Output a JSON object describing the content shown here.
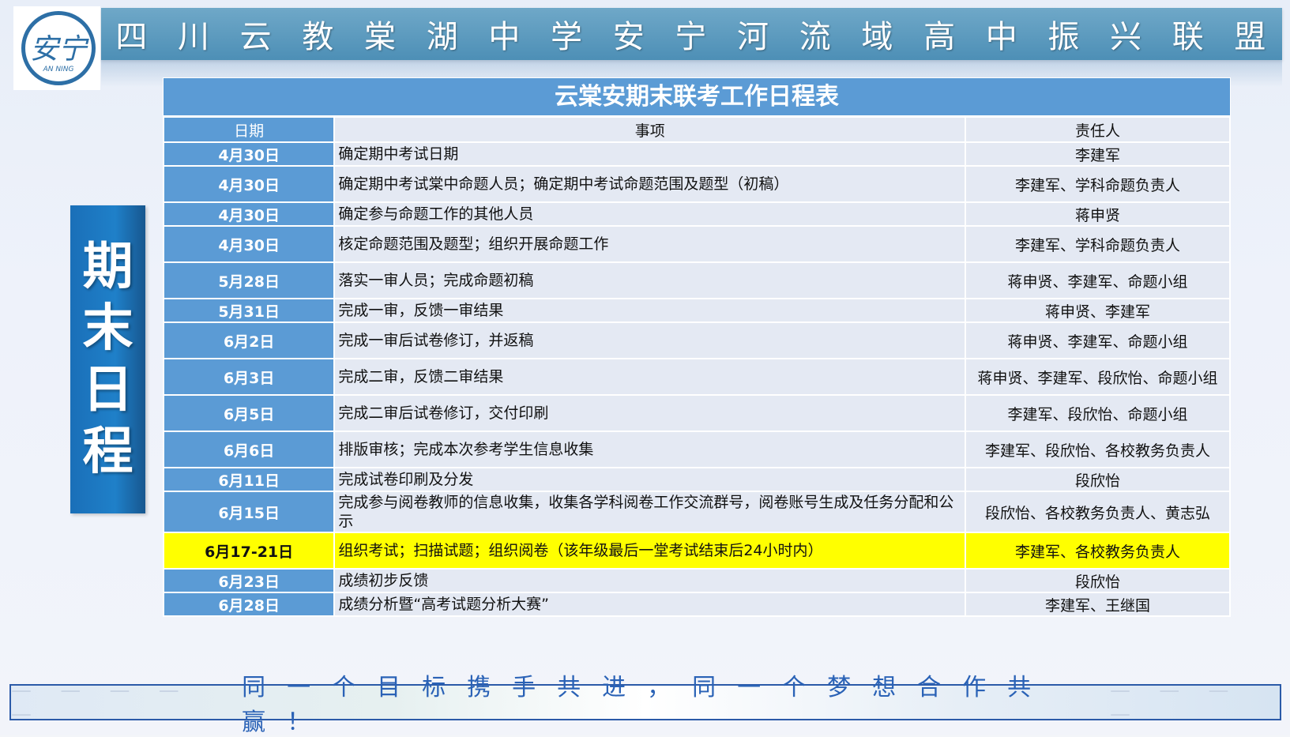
{
  "banner": {
    "chars": [
      "四",
      "川",
      "云",
      "教",
      "棠",
      "湖",
      "中",
      "学",
      "安",
      "宁",
      "河",
      "流",
      "域",
      "高",
      "中",
      "振",
      "兴",
      "联",
      "盟"
    ]
  },
  "logo": {
    "main": "安宁",
    "sub": "AN NING"
  },
  "side_title": [
    "期",
    "末",
    "日",
    "程"
  ],
  "table": {
    "title": "云棠安期末联考工作日程表",
    "headers": {
      "date": "日期",
      "item": "事项",
      "owner": "责任人"
    },
    "rows": [
      {
        "date": "4月30日",
        "item": "确定期中考试日期",
        "owner": "李建军"
      },
      {
        "date": "4月30日",
        "item": "确定期中考试棠中命题人员；确定期中考试命题范围及题型（初稿）",
        "owner": "李建军、学科命题负责人"
      },
      {
        "date": "4月30日",
        "item": "确定参与命题工作的其他人员",
        "owner": "蒋申贤"
      },
      {
        "date": "4月30日",
        "item": "核定命题范围及题型；组织开展命题工作",
        "owner": "李建军、学科命题负责人"
      },
      {
        "date": "5月28日",
        "item": "落实一审人员；完成命题初稿",
        "owner": "蒋申贤、李建军、命题小组"
      },
      {
        "date": "5月31日",
        "item": "完成一审，反馈一审结果",
        "owner": "蒋申贤、李建军"
      },
      {
        "date": "6月2日",
        "item": "完成一审后试卷修订，并返稿",
        "owner": "蒋申贤、李建军、命题小组"
      },
      {
        "date": "6月3日",
        "item": "完成二审，反馈二审结果",
        "owner": "蒋申贤、李建军、段欣怡、命题小组"
      },
      {
        "date": "6月5日",
        "item": "完成二审后试卷修订，交付印刷",
        "owner": "李建军、段欣怡、命题小组"
      },
      {
        "date": "6月6日",
        "item": "排版审核；完成本次参考学生信息收集",
        "owner": "李建军、段欣怡、各校教务负责人"
      },
      {
        "date": "6月11日",
        "item": "完成试卷印刷及分发",
        "owner": "段欣怡"
      },
      {
        "date": "6月15日",
        "item": "完成参与阅卷教师的信息收集，收集各学科阅卷工作交流群号，阅卷账号生成及任务分配和公示",
        "owner": "段欣怡、各校教务负责人、黄志弘"
      },
      {
        "date": "6月17-21日",
        "item": "组织考试；扫描试题；组织阅卷（该年级最后一堂考试结束后24小时内）",
        "owner": "李建军、各校教务负责人"
      },
      {
        "date": "6月23日",
        "item": "成绩初步反馈",
        "owner": "段欣怡"
      },
      {
        "date": "6月28日",
        "item": "成绩分析暨“高考试题分析大赛”",
        "owner": "李建军、王继国"
      }
    ]
  },
  "slogan": {
    "dashes_left": "— — — — —",
    "text": "同一个目标携手共进，同一个梦想合作共赢！",
    "dashes_right": "— — — —"
  },
  "colors": {
    "header_blue": "#5b9bd5",
    "row_light": "#e4e9f3",
    "highlight": "#ffff00",
    "side_blue": "#1f80c9",
    "slogan_text": "#2a62b6"
  }
}
